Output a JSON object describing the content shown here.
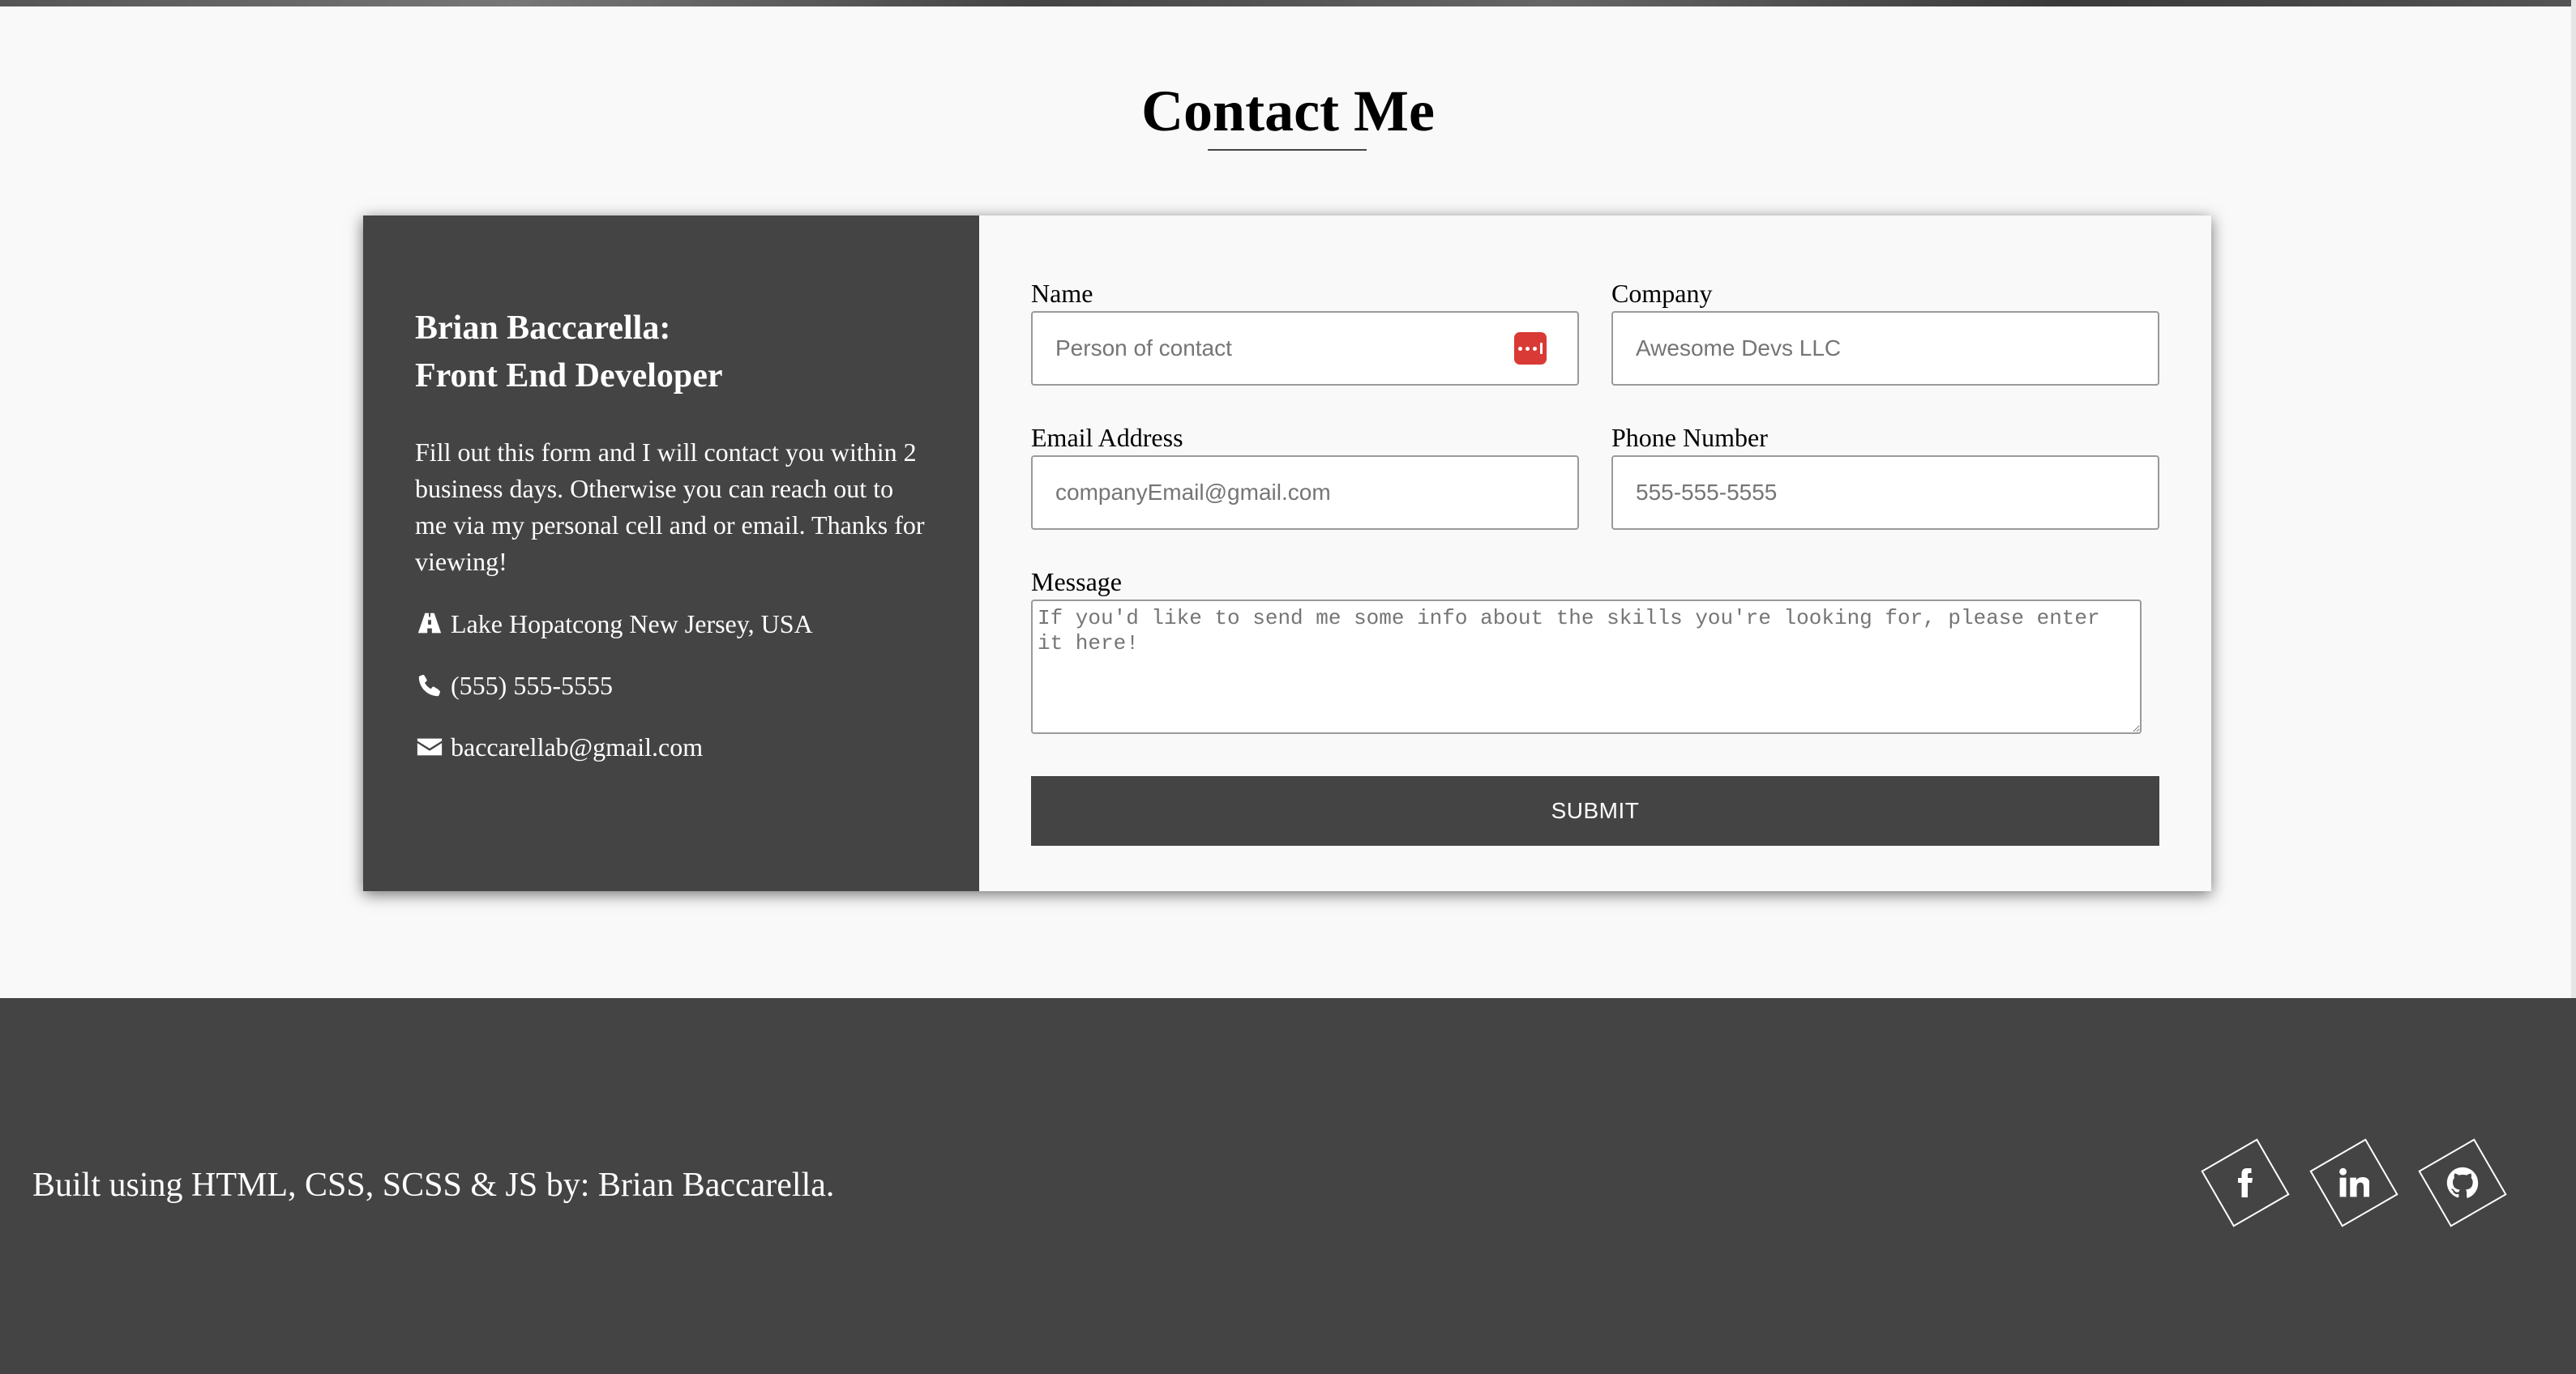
{
  "section": {
    "title": "Contact Me"
  },
  "info": {
    "name_line1": "Brian Baccarella:",
    "name_line2": "Front End Developer",
    "description": "Fill out this form and I will contact you within 2 business days. Otherwise you can reach out to me via my personal cell and or email. Thanks for viewing!",
    "location": "Lake Hopatcong New Jersey, USA",
    "phone": "(555) 555-5555",
    "email": "baccarellab@gmail.com",
    "location_icon": "road-icon",
    "phone_icon": "phone-icon",
    "email_icon": "envelope-icon"
  },
  "form": {
    "name_label": "Name",
    "name_placeholder": "Person of contact",
    "company_label": "Company",
    "company_placeholder": "Awesome Devs LLC",
    "email_label": "Email Address",
    "email_placeholder": "companyEmail@gmail.com",
    "phone_label": "Phone Number",
    "phone_placeholder": "555-555-5555",
    "message_label": "Message",
    "message_placeholder": "If you'd like to send me some info about the skills you're looking for, please enter it here!",
    "submit_label": "SUBMIT"
  },
  "footer": {
    "text": "Built using HTML, CSS, SCSS & JS by: Brian Baccarella.",
    "social": [
      {
        "icon": "facebook-icon"
      },
      {
        "icon": "linkedin-icon"
      },
      {
        "icon": "github-icon"
      }
    ]
  },
  "colors": {
    "panel": "#444444",
    "background": "#f9f9f9",
    "password_badge": "#d93a35"
  }
}
